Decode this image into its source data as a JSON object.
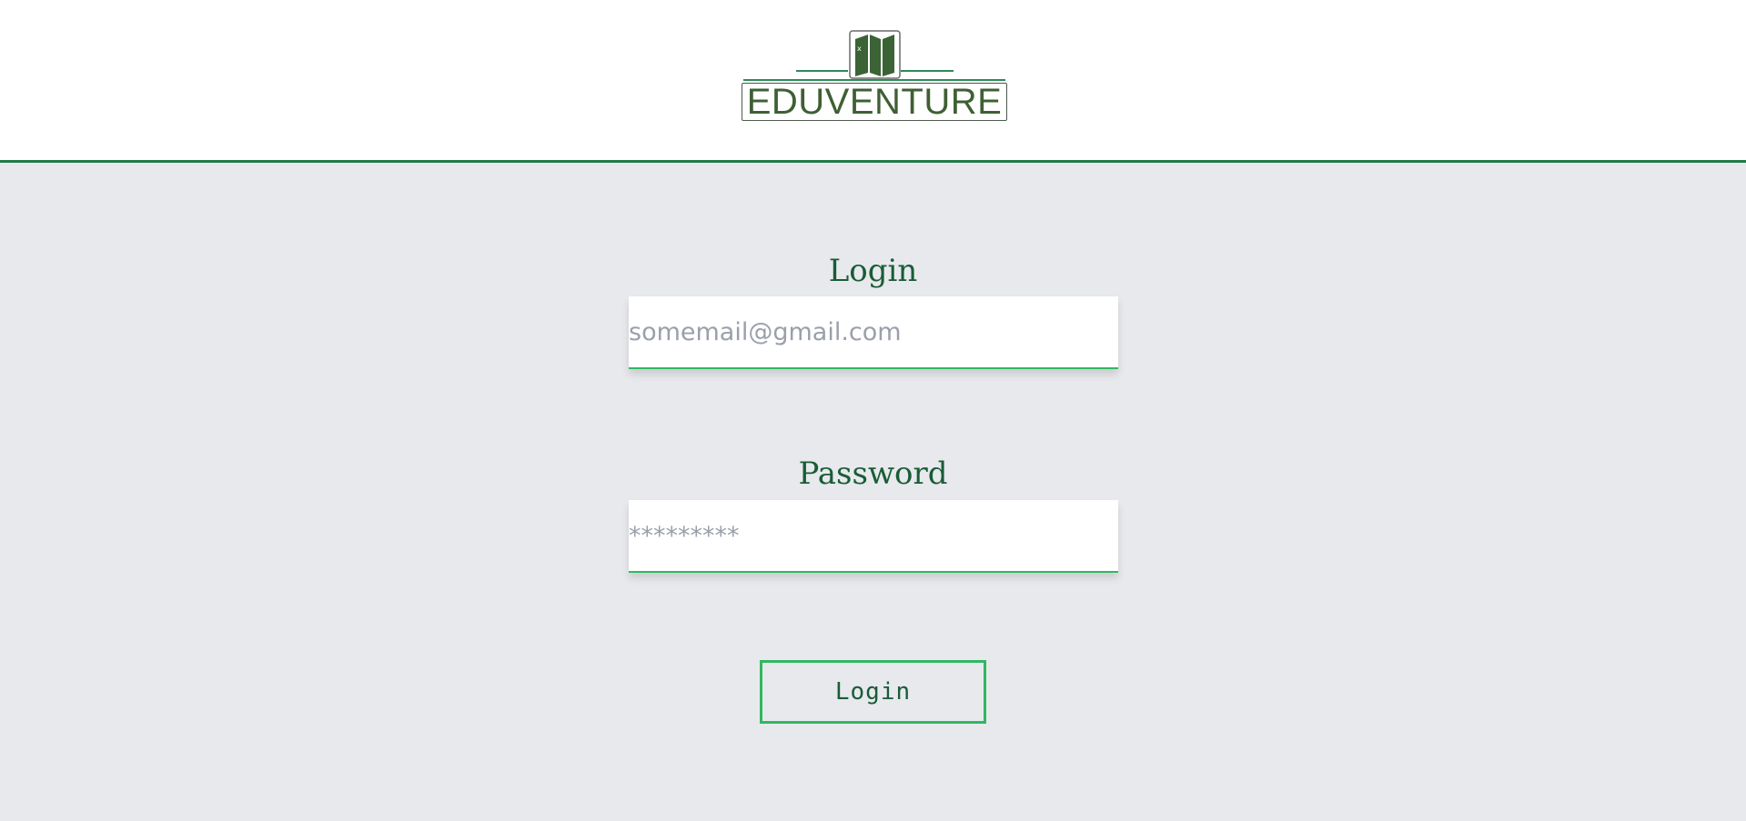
{
  "brand": {
    "name": "EDUVENTURE",
    "colors": {
      "primary_green": "#1f7a46",
      "logo_green": "#3e5f33",
      "accent_green": "#30b860",
      "background": "#e7e9ed"
    },
    "icon": "folded-map-icon"
  },
  "login_form": {
    "email_label": "Login",
    "email_placeholder": "somemail@gmail.com",
    "password_label": "Password",
    "password_placeholder": "*********",
    "submit_label": "Login"
  }
}
